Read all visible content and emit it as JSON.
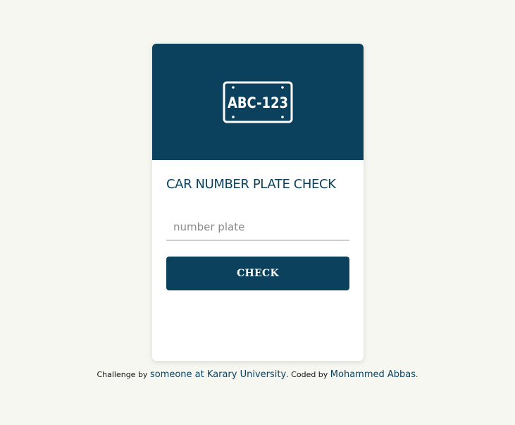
{
  "header": {
    "plate_text": "ABC-123",
    "icon": "license-plate-icon"
  },
  "form": {
    "title": "CAR NUMBER PLATE CHECK",
    "input_placeholder": "number plate",
    "input_value": "",
    "button_label": "CHECK"
  },
  "footer": {
    "challenge_prefix": "Challenge by",
    "challenge_link": "someone at Karary University",
    "coded_prefix": ". Coded by",
    "author_link": "Mohammed Abbas",
    "suffix": "."
  },
  "colors": {
    "primary": "#0b415c",
    "background": "#f7f7f2",
    "card": "#ffffff"
  }
}
